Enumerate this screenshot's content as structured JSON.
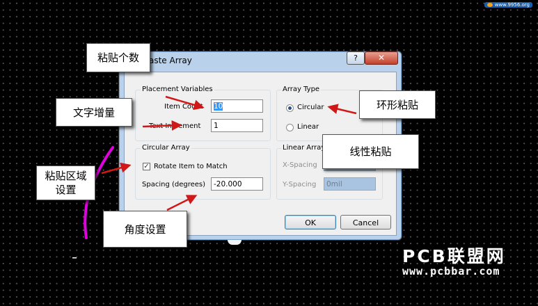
{
  "watermark": "www.9956.org",
  "dialog": {
    "title": "aste Array",
    "help_label": "?",
    "close_label": "✕",
    "placement": {
      "group_label": "Placement  Variables",
      "item_count_label": "Item Count",
      "item_count_value": "10",
      "text_increment_label": "Text Increment",
      "text_increment_value": "1"
    },
    "array_type": {
      "group_label": "Array Type",
      "options": [
        "Circular",
        "Linear"
      ],
      "selected": "Circular"
    },
    "circular": {
      "group_label": "Circular Array",
      "rotate_label": "Rotate Item to Match",
      "rotate_checked": true,
      "spacing_label": "Spacing (degrees)",
      "spacing_value": "-20.000"
    },
    "linear": {
      "group_label": "Linear Array",
      "x_spacing_label": "X-Spacing",
      "x_spacing_value": "",
      "y_spacing_label": "Y-Spacing",
      "y_spacing_value": "0mil"
    },
    "ok_label": "OK",
    "cancel_label": "Cancel"
  },
  "annotations": {
    "paste_count": "粘贴个数",
    "text_increment": "文字增量",
    "circular_paste": "环形粘贴",
    "linear_paste": "线性粘贴",
    "paste_area_settings": "粘贴区域设置",
    "angle_settings": "角度设置"
  },
  "brand": {
    "name": "PCB联盟网",
    "url": "www.pcbbar.com"
  },
  "colors": {
    "arrow": "#d01818",
    "trace": "#e000e0",
    "dialog_frame": "#b9d1ea",
    "selection": "#3399ff"
  }
}
